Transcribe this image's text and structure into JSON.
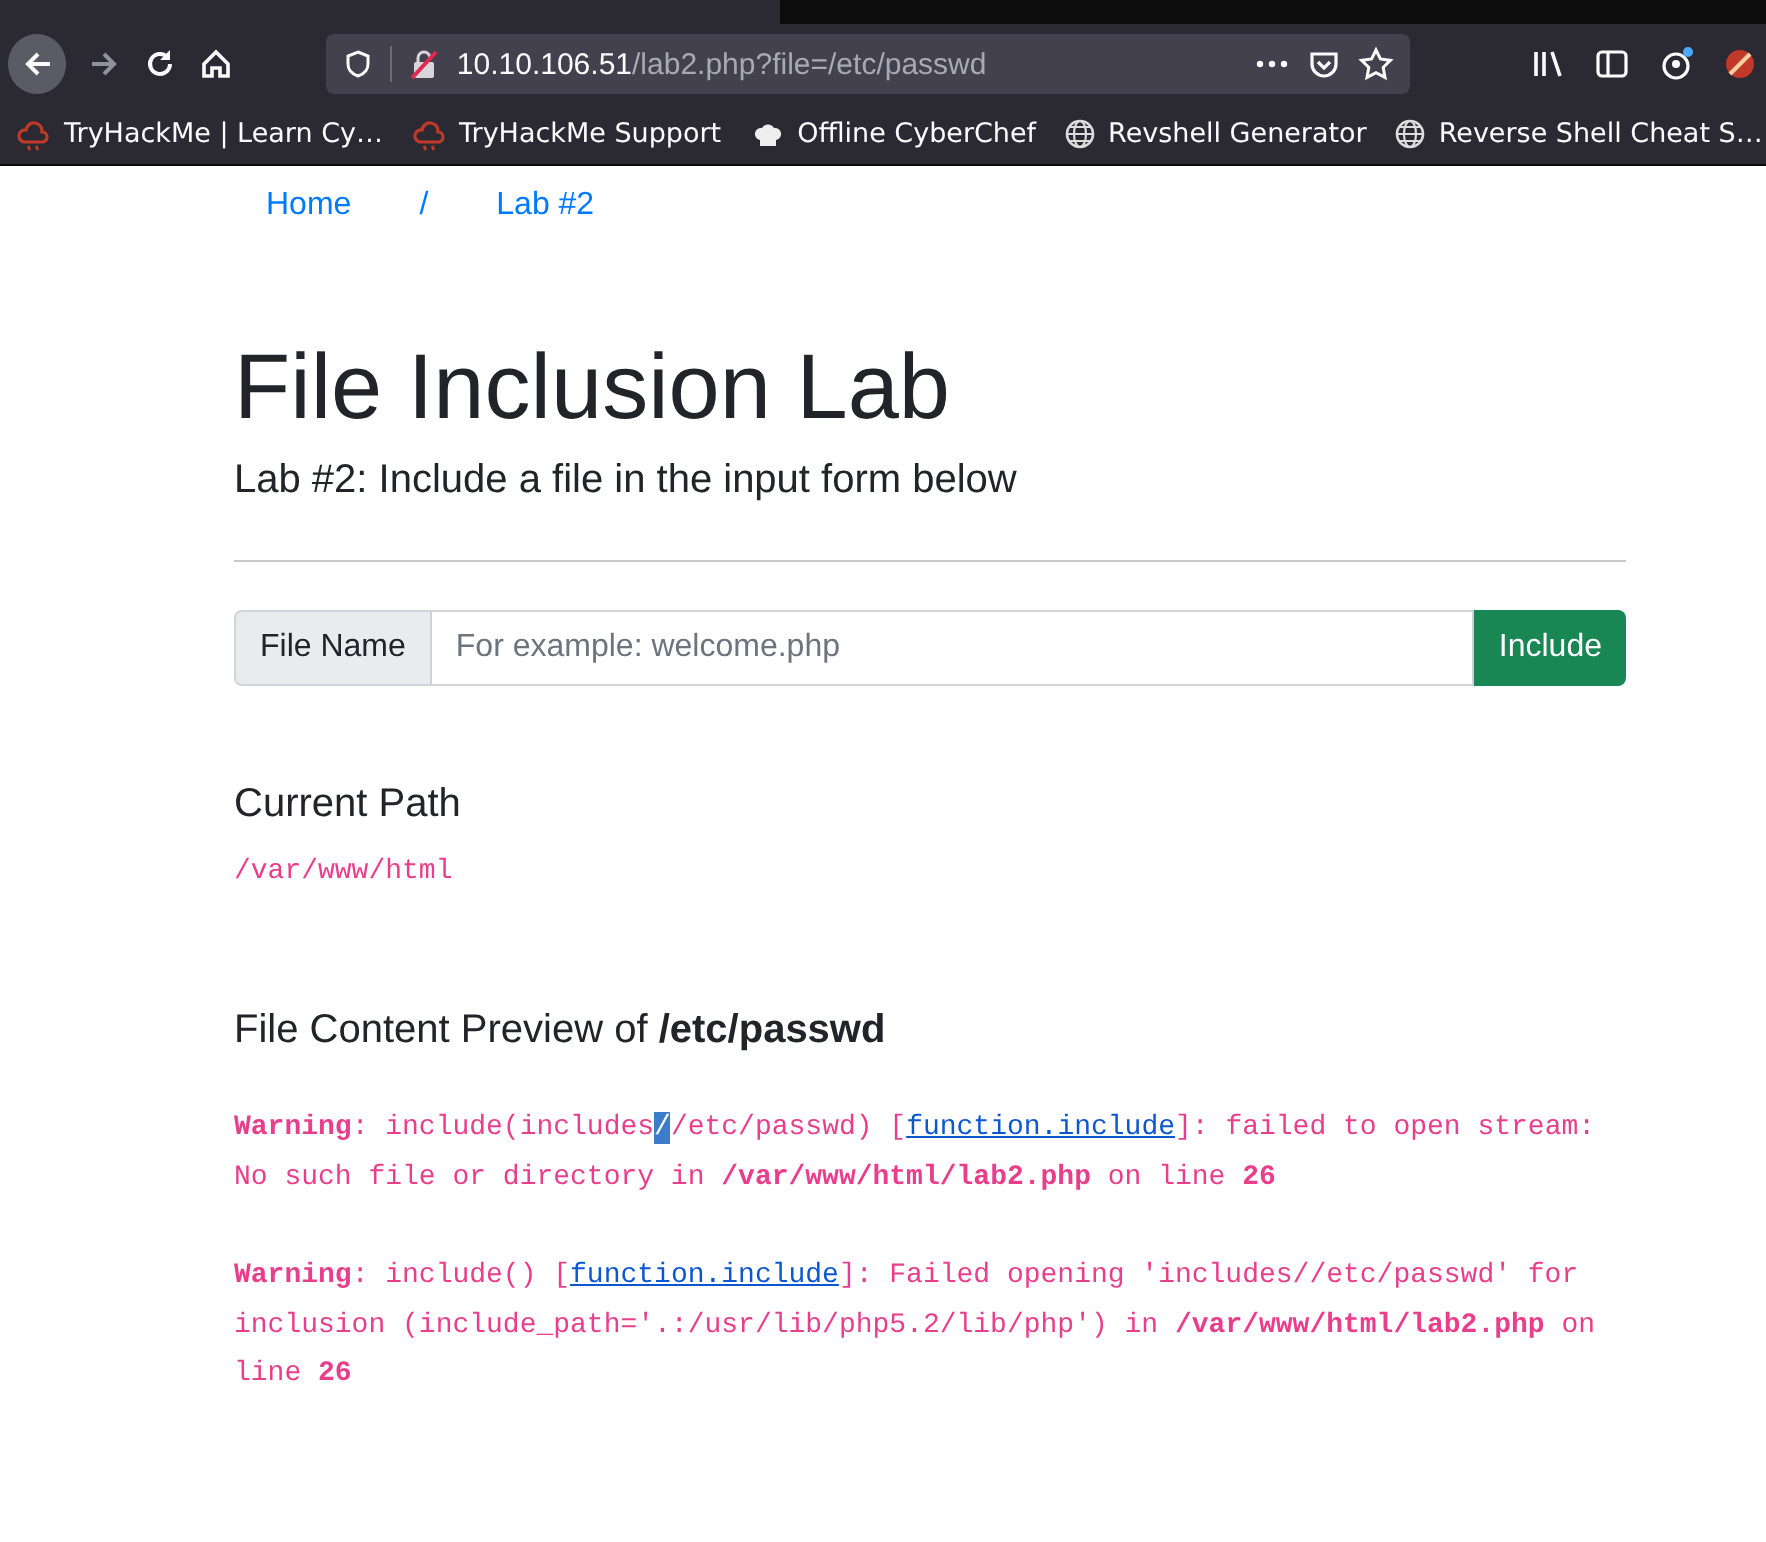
{
  "browser": {
    "url_host": "10.10.106.51",
    "url_path": "/lab2.php?file=/etc/passwd",
    "bookmarks": [
      {
        "label": "TryHackMe | Learn Cy…",
        "kind": "cloud"
      },
      {
        "label": "TryHackMe Support",
        "kind": "cloud"
      },
      {
        "label": "Offline CyberChef",
        "kind": "chef"
      },
      {
        "label": "Revshell Generator",
        "kind": "globe"
      },
      {
        "label": "Reverse Shell Cheat S…",
        "kind": "globe"
      }
    ]
  },
  "breadcrumb": {
    "items": [
      "Home",
      "Lab #2"
    ],
    "separator": "/"
  },
  "heading": "File Inclusion Lab",
  "subheading": "Lab #2: Include a file in the input form below",
  "form": {
    "label": "File Name",
    "placeholder": "For example: welcome.php",
    "button": "Include"
  },
  "current_path": {
    "title": "Current Path",
    "value": "/var/www/html"
  },
  "preview": {
    "title_prefix": "File Content Preview of ",
    "title_file": "/etc/passwd",
    "warnings": [
      [
        {
          "kind": "bold",
          "text": "Warning"
        },
        {
          "kind": "plain",
          "text": ": include(includes"
        },
        {
          "kind": "selected",
          "text": "/"
        },
        {
          "kind": "plain",
          "text": "/etc/passwd) ["
        },
        {
          "kind": "link",
          "text": "function.include"
        },
        {
          "kind": "plain",
          "text": "]: failed to open stream: No such file or directory in "
        },
        {
          "kind": "bold",
          "text": "/var/www/html/lab2.php"
        },
        {
          "kind": "plain",
          "text": " on line "
        },
        {
          "kind": "bold",
          "text": "26"
        }
      ],
      [
        {
          "kind": "bold",
          "text": "Warning"
        },
        {
          "kind": "plain",
          "text": ": include() ["
        },
        {
          "kind": "link",
          "text": "function.include"
        },
        {
          "kind": "plain",
          "text": "]: Failed opening 'includes//etc/passwd' for inclusion (include_path='.:/usr/lib/php5.2/lib/php') in "
        },
        {
          "kind": "bold",
          "text": "/var/www/html/lab2.php"
        },
        {
          "kind": "plain",
          "text": " on line "
        },
        {
          "kind": "bold",
          "text": "26"
        }
      ]
    ]
  }
}
